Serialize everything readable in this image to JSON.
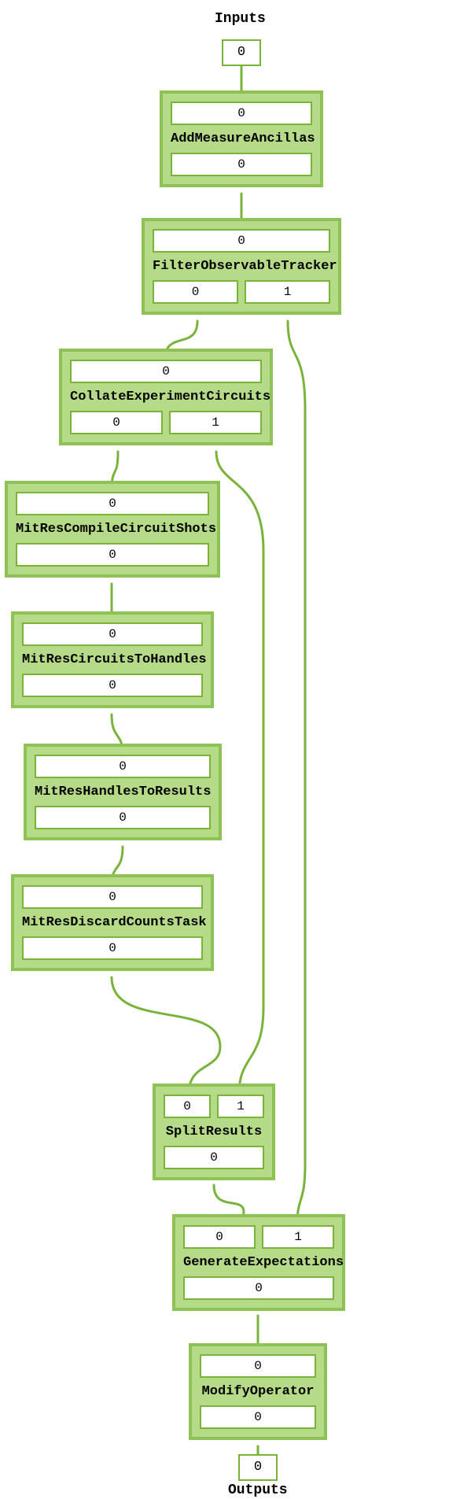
{
  "header_inputs": "Inputs",
  "header_outputs": "Outputs",
  "input_port": "0",
  "output_port": "0",
  "nodes": [
    {
      "id": "n0",
      "title": "AddMeasureAncillas",
      "inputs": [
        "0"
      ],
      "outputs": [
        "0"
      ]
    },
    {
      "id": "n1",
      "title": "FilterObservableTracker",
      "inputs": [
        "0"
      ],
      "outputs": [
        "0",
        "1"
      ]
    },
    {
      "id": "n2",
      "title": "CollateExperimentCircuits",
      "inputs": [
        "0"
      ],
      "outputs": [
        "0",
        "1"
      ]
    },
    {
      "id": "n3",
      "title": "MitResCompileCircuitShots",
      "inputs": [
        "0"
      ],
      "outputs": [
        "0"
      ]
    },
    {
      "id": "n4",
      "title": "MitResCircuitsToHandles",
      "inputs": [
        "0"
      ],
      "outputs": [
        "0"
      ]
    },
    {
      "id": "n5",
      "title": "MitResHandlesToResults",
      "inputs": [
        "0"
      ],
      "outputs": [
        "0"
      ]
    },
    {
      "id": "n6",
      "title": "MitResDiscardCountsTask",
      "inputs": [
        "0"
      ],
      "outputs": [
        "0"
      ]
    },
    {
      "id": "n7",
      "title": "SplitResults",
      "inputs": [
        "0",
        "1"
      ],
      "outputs": [
        "0"
      ]
    },
    {
      "id": "n8",
      "title": "GenerateExpectations",
      "inputs": [
        "0",
        "1"
      ],
      "outputs": [
        "0"
      ]
    },
    {
      "id": "n9",
      "title": "ModifyOperator",
      "inputs": [
        "0"
      ],
      "outputs": [
        "0"
      ]
    }
  ],
  "colors": {
    "node_bg": "#b5db88",
    "node_border": "#8fc254",
    "port_border": "#79b33a",
    "edge": "#79b33a"
  },
  "chart_data": {
    "type": "diagram",
    "title": "",
    "graph": {
      "inputs": [
        "Inputs.0"
      ],
      "outputs": [
        "Outputs.0"
      ],
      "nodes": [
        {
          "name": "AddMeasureAncillas",
          "in_ports": [
            0
          ],
          "out_ports": [
            0
          ]
        },
        {
          "name": "FilterObservableTracker",
          "in_ports": [
            0
          ],
          "out_ports": [
            0,
            1
          ]
        },
        {
          "name": "CollateExperimentCircuits",
          "in_ports": [
            0
          ],
          "out_ports": [
            0,
            1
          ]
        },
        {
          "name": "MitResCompileCircuitShots",
          "in_ports": [
            0
          ],
          "out_ports": [
            0
          ]
        },
        {
          "name": "MitResCircuitsToHandles",
          "in_ports": [
            0
          ],
          "out_ports": [
            0
          ]
        },
        {
          "name": "MitResHandlesToResults",
          "in_ports": [
            0
          ],
          "out_ports": [
            0
          ]
        },
        {
          "name": "MitResDiscardCountsTask",
          "in_ports": [
            0
          ],
          "out_ports": [
            0
          ]
        },
        {
          "name": "SplitResults",
          "in_ports": [
            0,
            1
          ],
          "out_ports": [
            0
          ]
        },
        {
          "name": "GenerateExpectations",
          "in_ports": [
            0,
            1
          ],
          "out_ports": [
            0
          ]
        },
        {
          "name": "ModifyOperator",
          "in_ports": [
            0
          ],
          "out_ports": [
            0
          ]
        }
      ],
      "edges": [
        {
          "from": "Inputs.0",
          "to": "AddMeasureAncillas.in.0"
        },
        {
          "from": "AddMeasureAncillas.out.0",
          "to": "FilterObservableTracker.in.0"
        },
        {
          "from": "FilterObservableTracker.out.0",
          "to": "CollateExperimentCircuits.in.0"
        },
        {
          "from": "FilterObservableTracker.out.1",
          "to": "GenerateExpectations.in.1"
        },
        {
          "from": "CollateExperimentCircuits.out.0",
          "to": "MitResCompileCircuitShots.in.0"
        },
        {
          "from": "CollateExperimentCircuits.out.1",
          "to": "SplitResults.in.1"
        },
        {
          "from": "MitResCompileCircuitShots.out.0",
          "to": "MitResCircuitsToHandles.in.0"
        },
        {
          "from": "MitResCircuitsToHandles.out.0",
          "to": "MitResHandlesToResults.in.0"
        },
        {
          "from": "MitResHandlesToResults.out.0",
          "to": "MitResDiscardCountsTask.in.0"
        },
        {
          "from": "MitResDiscardCountsTask.out.0",
          "to": "SplitResults.in.0"
        },
        {
          "from": "SplitResults.out.0",
          "to": "GenerateExpectations.in.0"
        },
        {
          "from": "GenerateExpectations.out.0",
          "to": "ModifyOperator.in.0"
        },
        {
          "from": "ModifyOperator.out.0",
          "to": "Outputs.0"
        }
      ]
    }
  }
}
